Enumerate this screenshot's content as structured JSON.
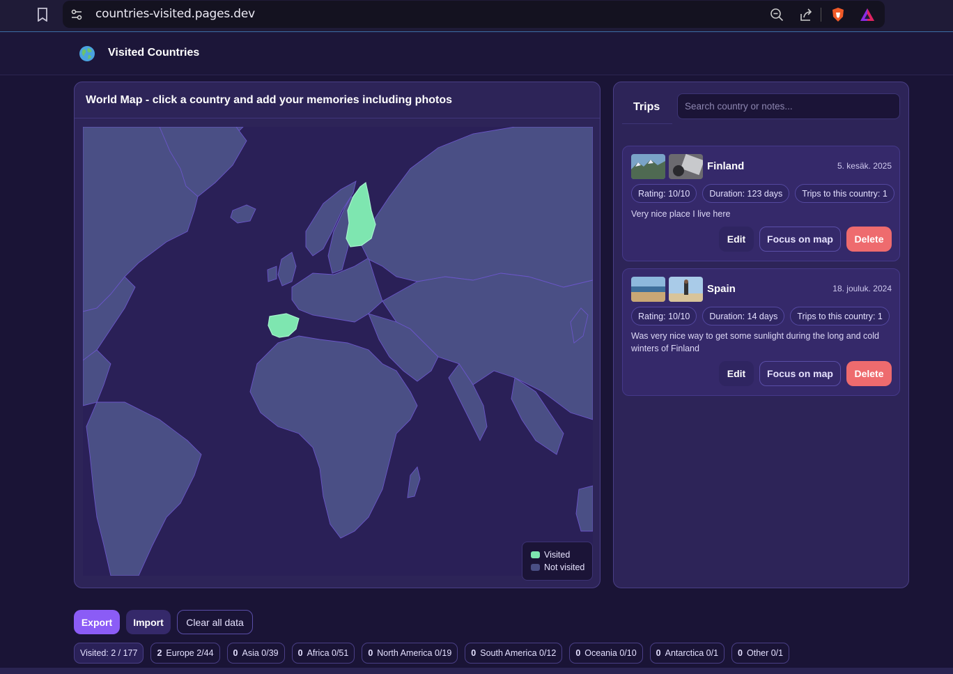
{
  "browser": {
    "url": "countries-visited.pages.dev",
    "icons": [
      "bookmark-icon",
      "site-settings-icon",
      "zoom-out-icon",
      "share-icon",
      "brave-shield-icon",
      "brave-rewards-icon"
    ]
  },
  "app": {
    "title": "Visited Countries",
    "logo": "globe-icon"
  },
  "map": {
    "heading": "World Map - click a country and add your memories including photos",
    "legend": {
      "visited": "Visited",
      "not_visited": "Not visited"
    },
    "colors": {
      "visited": "#7ee6b0",
      "not_visited": "#4a4f85",
      "ocean": "#2a2057",
      "border": "#6a56c8"
    },
    "visited_countries": [
      "Finland",
      "Spain"
    ]
  },
  "trips": {
    "tab_label": "Trips",
    "search_placeholder": "Search country or notes...",
    "items": [
      {
        "country": "Finland",
        "date": "5. kesäk. 2025",
        "rating": "Rating: 10/10",
        "duration": "Duration: 123 days",
        "trips_count": "Trips to this country: 1",
        "note": "Very nice place I live here",
        "edit": "Edit",
        "focus": "Focus on map",
        "delete": "Delete"
      },
      {
        "country": "Spain",
        "date": "18. jouluk. 2024",
        "rating": "Rating: 10/10",
        "duration": "Duration: 14 days",
        "trips_count": "Trips to this country: 1",
        "note": "Was very nice way to get some sunlight during the long and cold winters of Finland",
        "edit": "Edit",
        "focus": "Focus on map",
        "delete": "Delete"
      }
    ]
  },
  "toolbar": {
    "export": "Export",
    "import": "Import",
    "clear": "Clear all data"
  },
  "stats": [
    {
      "label": "Visited: 2 / 177"
    },
    {
      "count": "2",
      "label": "Europe 2/44"
    },
    {
      "count": "0",
      "label": "Asia 0/39"
    },
    {
      "count": "0",
      "label": "Africa 0/51"
    },
    {
      "count": "0",
      "label": "North America 0/19"
    },
    {
      "count": "0",
      "label": "South America 0/12"
    },
    {
      "count": "0",
      "label": "Oceania 0/10"
    },
    {
      "count": "0",
      "label": "Antarctica 0/1"
    },
    {
      "count": "0",
      "label": "Other 0/1"
    }
  ]
}
